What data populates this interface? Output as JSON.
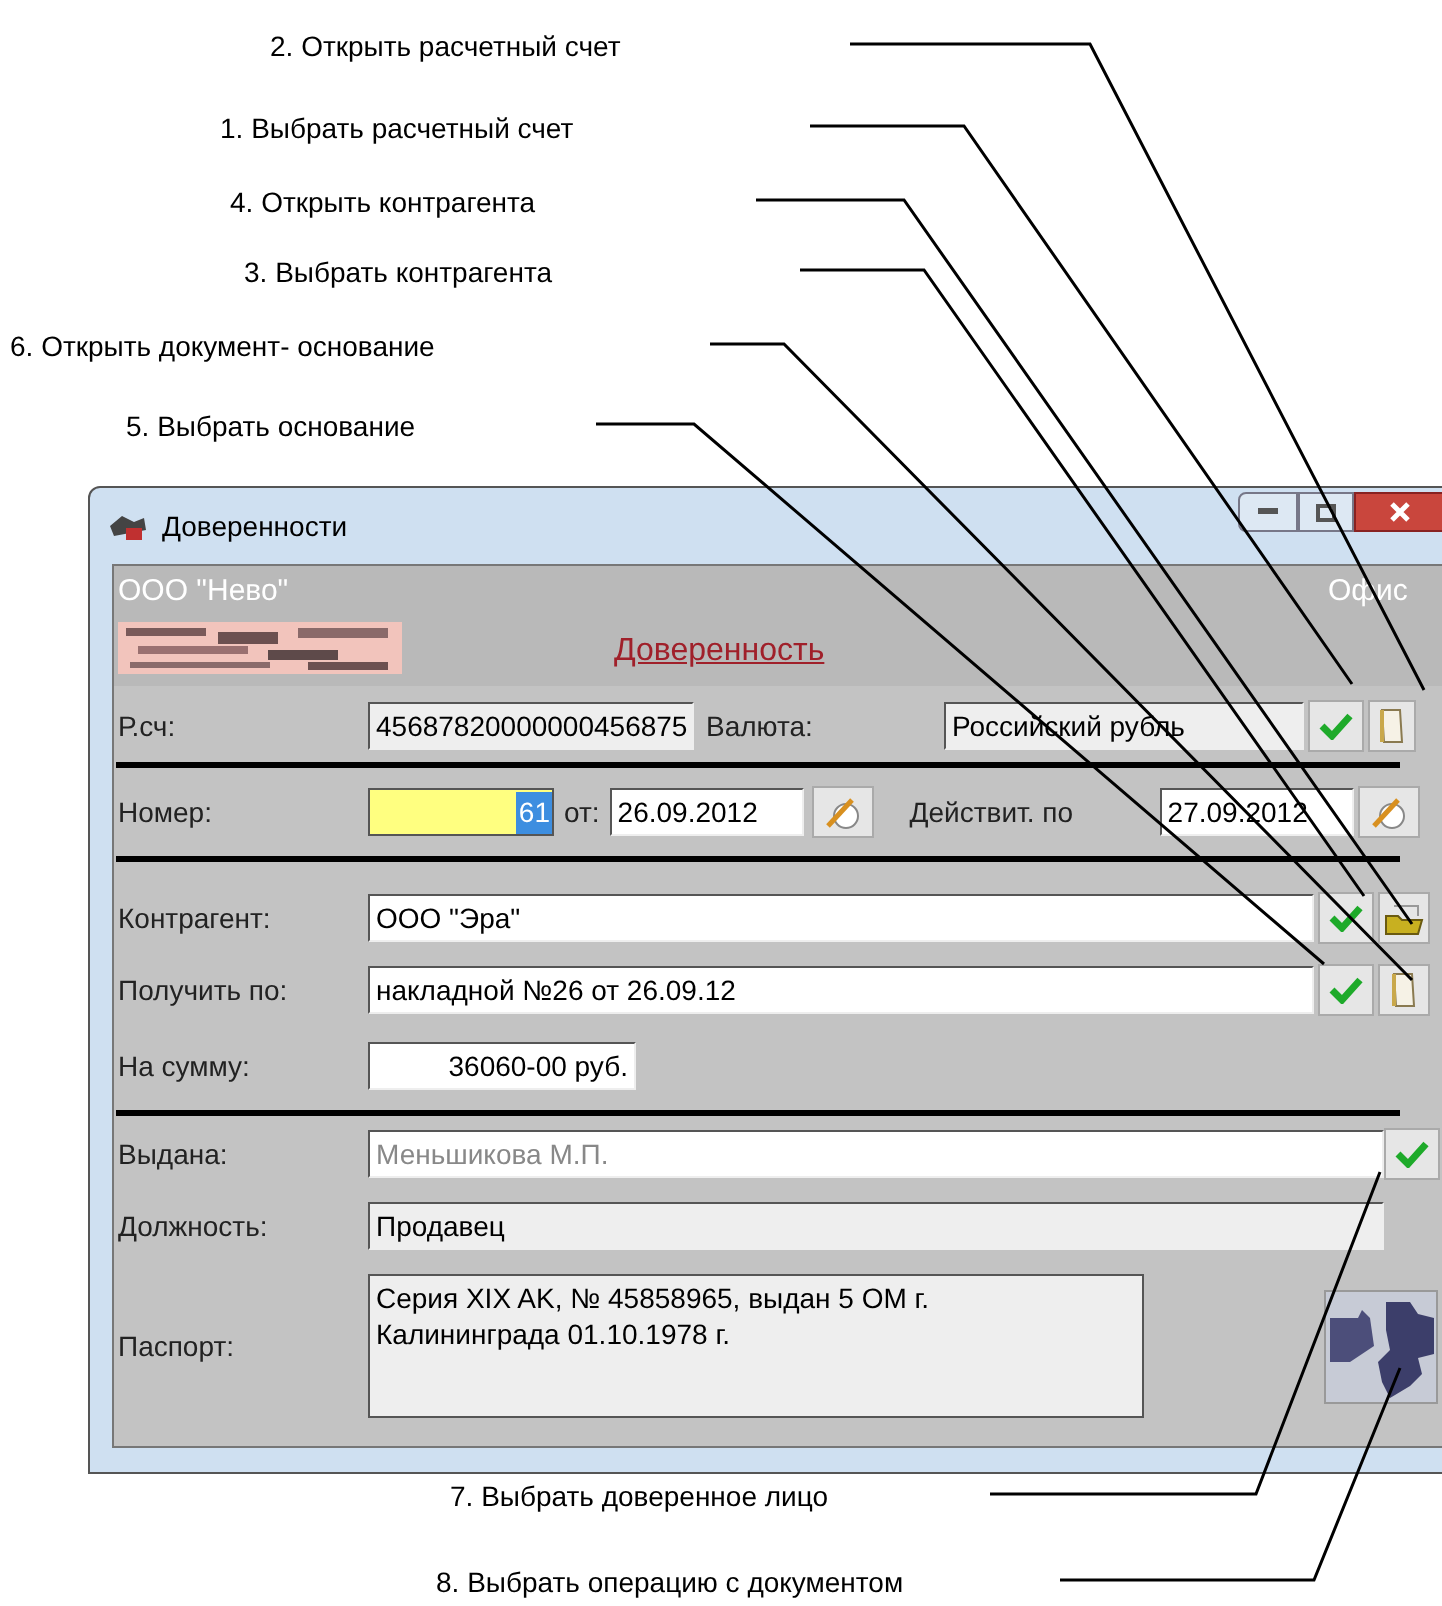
{
  "annotations": [
    {
      "label": "2. Открыть расчетный счет"
    },
    {
      "label": "1. Выбрать расчетный счет"
    },
    {
      "label": "4. Открыть контрагента"
    },
    {
      "label": "3. Выбрать контрагента"
    },
    {
      "label": "6. Открыть документ- основание"
    },
    {
      "label": "5. Выбрать основание"
    },
    {
      "label": "7. Выбрать доверенное лицо"
    },
    {
      "label": "8. Выбрать операцию с документом"
    }
  ],
  "window": {
    "title": "Доверенности"
  },
  "header": {
    "company": "ООО \"Нево\"",
    "office": "Офис",
    "document_title": "Доверенность"
  },
  "account_row": {
    "label": "Р.сч:",
    "account": "45687820000000456875",
    "currency_label": "Валюта:",
    "currency": "Российский рубль"
  },
  "number_row": {
    "label": "Номер:",
    "number": "61",
    "number_selected": true,
    "from_label": "от:",
    "from_date": "26.09.2012",
    "valid_label": "Действит. по",
    "valid_date": "27.09.2012"
  },
  "counterparty": {
    "label": "Контрагент:",
    "value": "ООО \"Эра\""
  },
  "basis": {
    "label": "Получить по:",
    "value": "накладной №26 от 26.09.12"
  },
  "amount": {
    "label": "На сумму:",
    "value": "36060-00 руб."
  },
  "issued_to": {
    "label": "Выдана:",
    "value": "Меньшикова М.П.",
    "disabled": true
  },
  "position": {
    "label": "Должность:",
    "value": "Продавец"
  },
  "passport": {
    "label": "Паспорт:",
    "value": "Серия XIX AK, № 45858965, выдан 5 ОМ г.\nКалининграда 01.10.1978 г."
  }
}
